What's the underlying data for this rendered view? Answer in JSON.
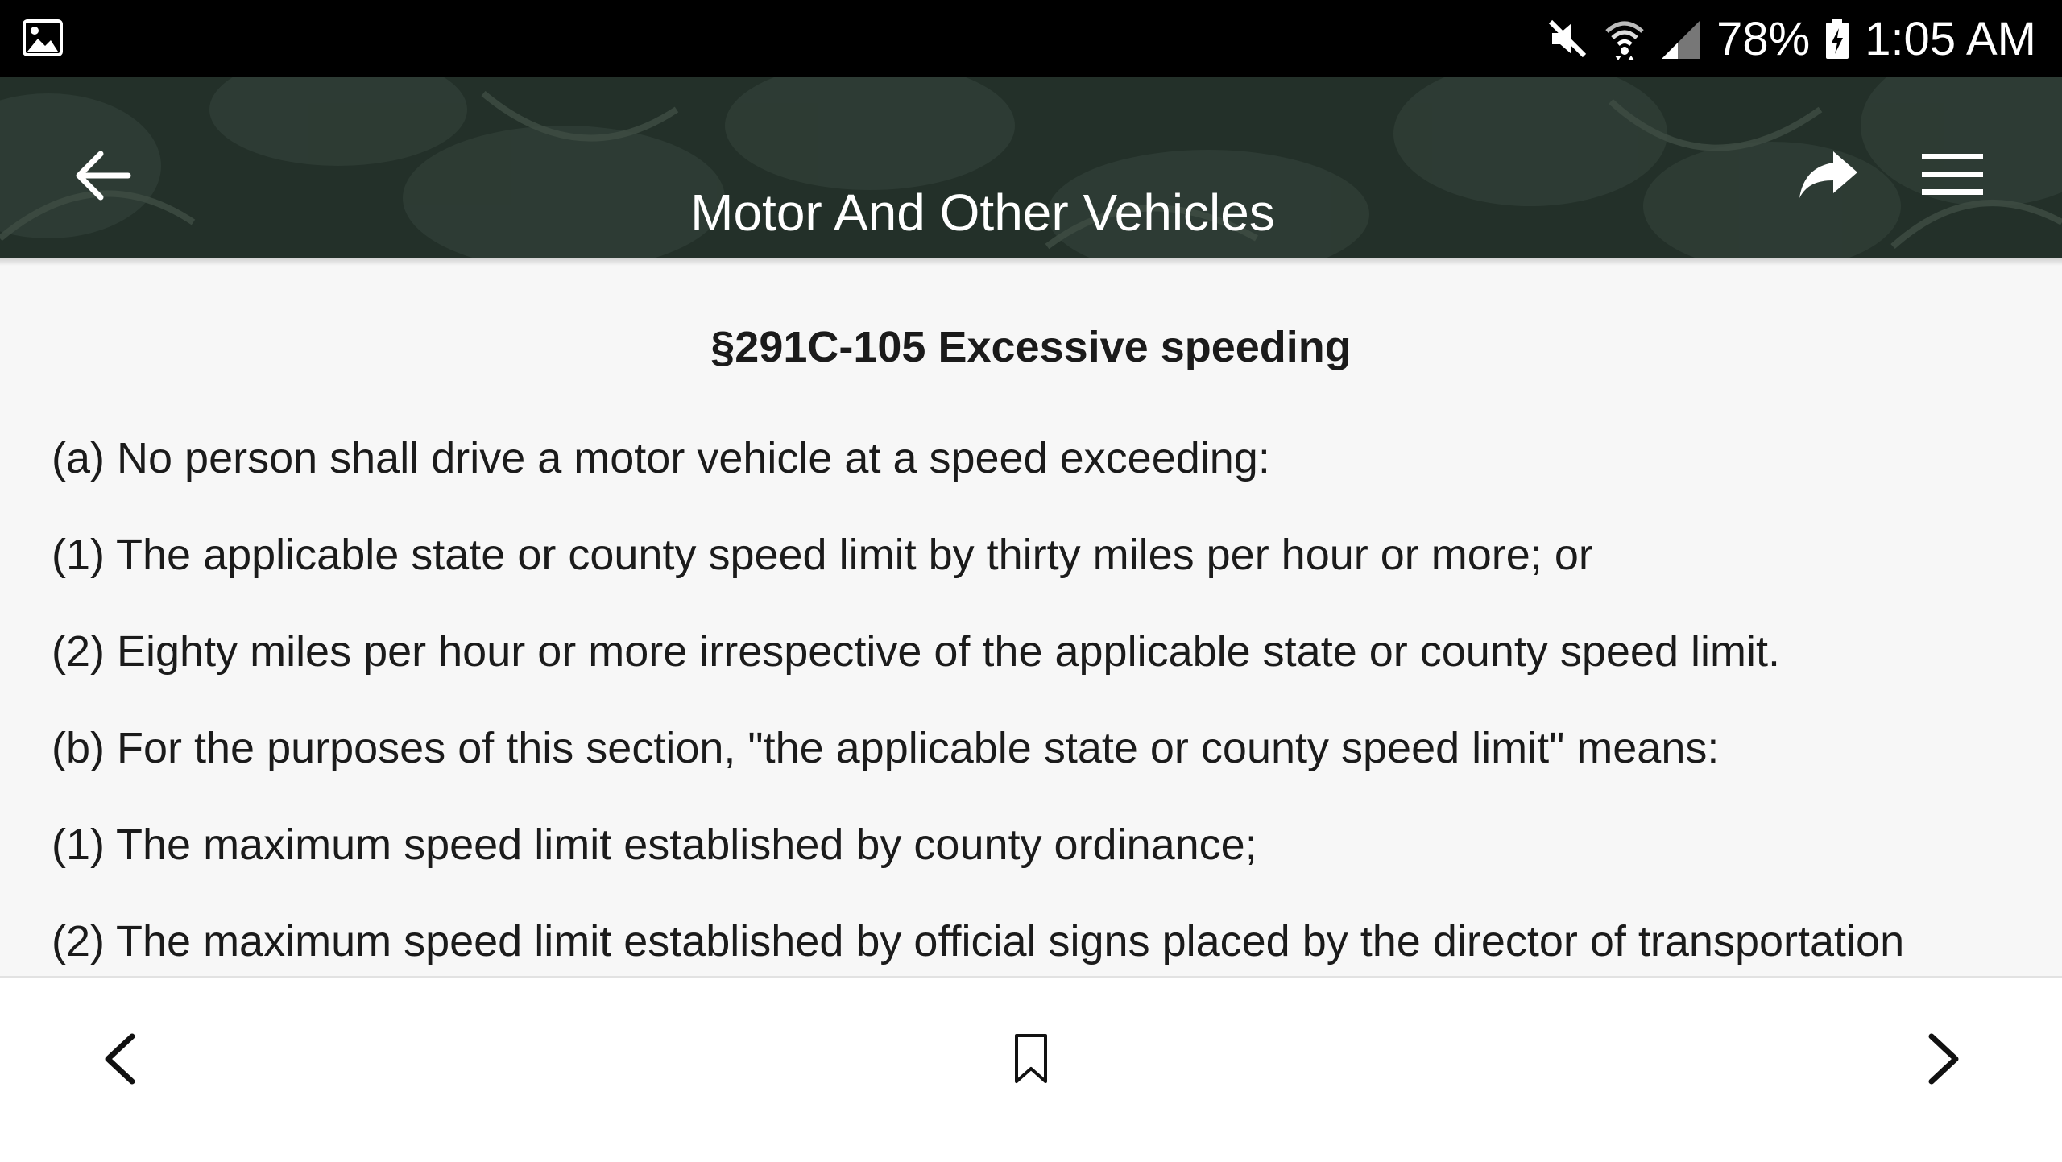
{
  "status_bar": {
    "icons": [
      "image-icon",
      "mute-icon",
      "wifi-icon",
      "cell-signal-icon",
      "battery-charging-icon"
    ],
    "battery_percent": "78%",
    "time": "1:05 AM"
  },
  "app_bar": {
    "title": "Motor And Other Vehicles",
    "icons": [
      "back-arrow-icon",
      "share-icon",
      "menu-icon"
    ]
  },
  "content": {
    "heading": "§291C-105 Excessive speeding",
    "paragraphs": [
      "(a) No person shall drive a motor vehicle at a speed exceeding:",
      "(1) The applicable state or county speed limit by thirty miles per hour or more; or",
      "(2) Eighty miles per hour or more irrespective of the applicable state or county speed limit.",
      "(b) For the purposes of this section, \"the applicable state or county speed limit\" means:",
      "(1) The maximum speed limit established by county ordinance;",
      "(2) The maximum speed limit established by official signs placed by the director of transportation"
    ]
  },
  "bottom_bar": {
    "icons": [
      "chevron-left-icon",
      "bookmark-icon",
      "chevron-right-icon"
    ]
  },
  "colors": {
    "status_bar": "#000000",
    "app_bar": "#233029",
    "content_bg": "#f7f7f7",
    "text": "#1b1b1b",
    "bottom_bar": "#ffffff"
  }
}
